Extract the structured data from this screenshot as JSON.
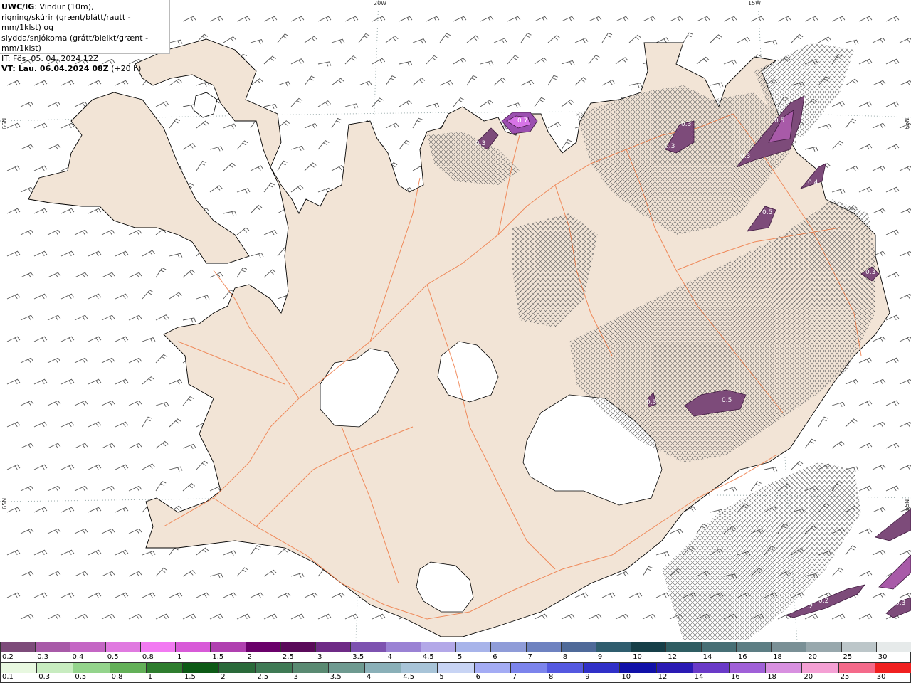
{
  "header": {
    "product": "UWC/IG",
    "description_1": ": Vindur (10m),",
    "description_2": "rigning/skúrir (grænt/blátt/rautt - mm/1klst) og",
    "description_3": "slydda/snjókoma (grátt/bleikt/grænt - mm/1klst)",
    "issue_time": "IT: Fös. 05. 04. 2024 12Z",
    "valid_prefix": "VT: Lau. 06.04.2024 08Z",
    "valid_suffix": " (+20 h)"
  },
  "axes": {
    "lon_20w": "20W",
    "lon_15w": "15W",
    "lat_66n_left": "66N",
    "lat_65n_left": "65N",
    "lat_66n_right": "66N",
    "lat_65n_right": "65N"
  },
  "map_labels": [
    {
      "text": "0.3"
    },
    {
      "text": "0.7"
    },
    {
      "text": "0.3"
    },
    {
      "text": "0.3"
    },
    {
      "text": "0.3"
    },
    {
      "text": "0.3"
    },
    {
      "text": "0.5"
    },
    {
      "text": "0.3"
    },
    {
      "text": "0.5"
    },
    {
      "text": "0.3"
    },
    {
      "text": "0.4"
    },
    {
      "text": "0.5"
    },
    {
      "text": "0.3"
    },
    {
      "text": "0.2"
    },
    {
      "text": "0.2"
    },
    {
      "text": "0.3"
    }
  ],
  "scale_snow": {
    "labels": [
      "0.2",
      "0.3",
      "0.4",
      "0.5",
      "0.8",
      "1",
      "1.5",
      "2",
      "2.5",
      "3",
      "3.5",
      "4",
      "4.5",
      "5",
      "6",
      "7",
      "8",
      "9",
      "10",
      "12",
      "14",
      "16",
      "18",
      "20",
      "25",
      "30"
    ],
    "colors": [
      "#7d4b7a",
      "#a85aa8",
      "#c466c4",
      "#e07ae0",
      "#f27af2",
      "#d85ad8",
      "#b040b0",
      "#6a006a",
      "#5a0a5a",
      "#6e2a86",
      "#7d52b0",
      "#9a82d4",
      "#b3a8e8",
      "#a8b4ea",
      "#8f9cd8",
      "#6e82c0",
      "#4f6a99",
      "#2f5d6e",
      "#163f48",
      "#2f5d62",
      "#476f75",
      "#5d7e84",
      "#7a9096",
      "#98a8ad",
      "#bcc6c9",
      "#e6eaea"
    ]
  },
  "scale_rain": {
    "labels": [
      "0.1",
      "0.3",
      "0.5",
      "0.8",
      "1",
      "1.5",
      "2",
      "2.5",
      "3",
      "3.5",
      "4",
      "4.5",
      "5",
      "6",
      "7",
      "8",
      "9",
      "10",
      "12",
      "14",
      "16",
      "18",
      "20",
      "25",
      "30"
    ],
    "colors": [
      "#e8f8e0",
      "#c8ecc0",
      "#94d48c",
      "#63b058",
      "#2e7d2e",
      "#0d5a16",
      "#2a6a3a",
      "#3f7a55",
      "#5a8a72",
      "#6e9a90",
      "#8ab0b8",
      "#a8c4d8",
      "#c8d4f4",
      "#a4acf4",
      "#7c84ec",
      "#5458e0",
      "#3030c8",
      "#1010a8",
      "#2a1ab4",
      "#6a3ac8",
      "#a060d8",
      "#d890e0",
      "#f4a0d4",
      "#f46a8a",
      "#f02020"
    ]
  }
}
